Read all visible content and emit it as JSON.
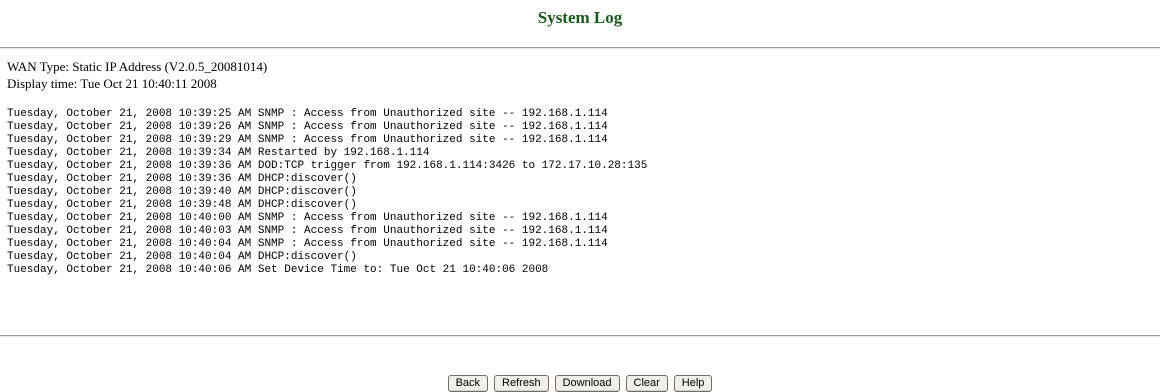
{
  "page": {
    "title": "System Log",
    "wan_type": "WAN Type: Static IP Address (V2.0.5_20081014)",
    "display_time": "Display time: Tue Oct 21 10:40:11 2008"
  },
  "log": {
    "lines": [
      "Tuesday, October 21, 2008 10:39:25 AM SNMP : Access from Unauthorized site -- 192.168.1.114",
      "Tuesday, October 21, 2008 10:39:26 AM SNMP : Access from Unauthorized site -- 192.168.1.114",
      "Tuesday, October 21, 2008 10:39:29 AM SNMP : Access from Unauthorized site -- 192.168.1.114",
      "Tuesday, October 21, 2008 10:39:34 AM Restarted by 192.168.1.114",
      "Tuesday, October 21, 2008 10:39:36 AM DOD:TCP trigger from 192.168.1.114:3426 to 172.17.10.28:135",
      "Tuesday, October 21, 2008 10:39:36 AM DHCP:discover()",
      "Tuesday, October 21, 2008 10:39:40 AM DHCP:discover()",
      "Tuesday, October 21, 2008 10:39:48 AM DHCP:discover()",
      "Tuesday, October 21, 2008 10:40:00 AM SNMP : Access from Unauthorized site -- 192.168.1.114",
      "Tuesday, October 21, 2008 10:40:03 AM SNMP : Access from Unauthorized site -- 192.168.1.114",
      "Tuesday, October 21, 2008 10:40:04 AM SNMP : Access from Unauthorized site -- 192.168.1.114",
      "Tuesday, October 21, 2008 10:40:04 AM DHCP:discover()",
      "Tuesday, October 21, 2008 10:40:06 AM Set Device Time to: Tue Oct 21 10:40:06 2008"
    ]
  },
  "buttons": {
    "back": "Back",
    "refresh": "Refresh",
    "download": "Download",
    "clear": "Clear",
    "help": "Help"
  },
  "colors": {
    "title": "#1a5a1a",
    "rule": "#9a9a9a",
    "button_bg": "#f0efea"
  }
}
